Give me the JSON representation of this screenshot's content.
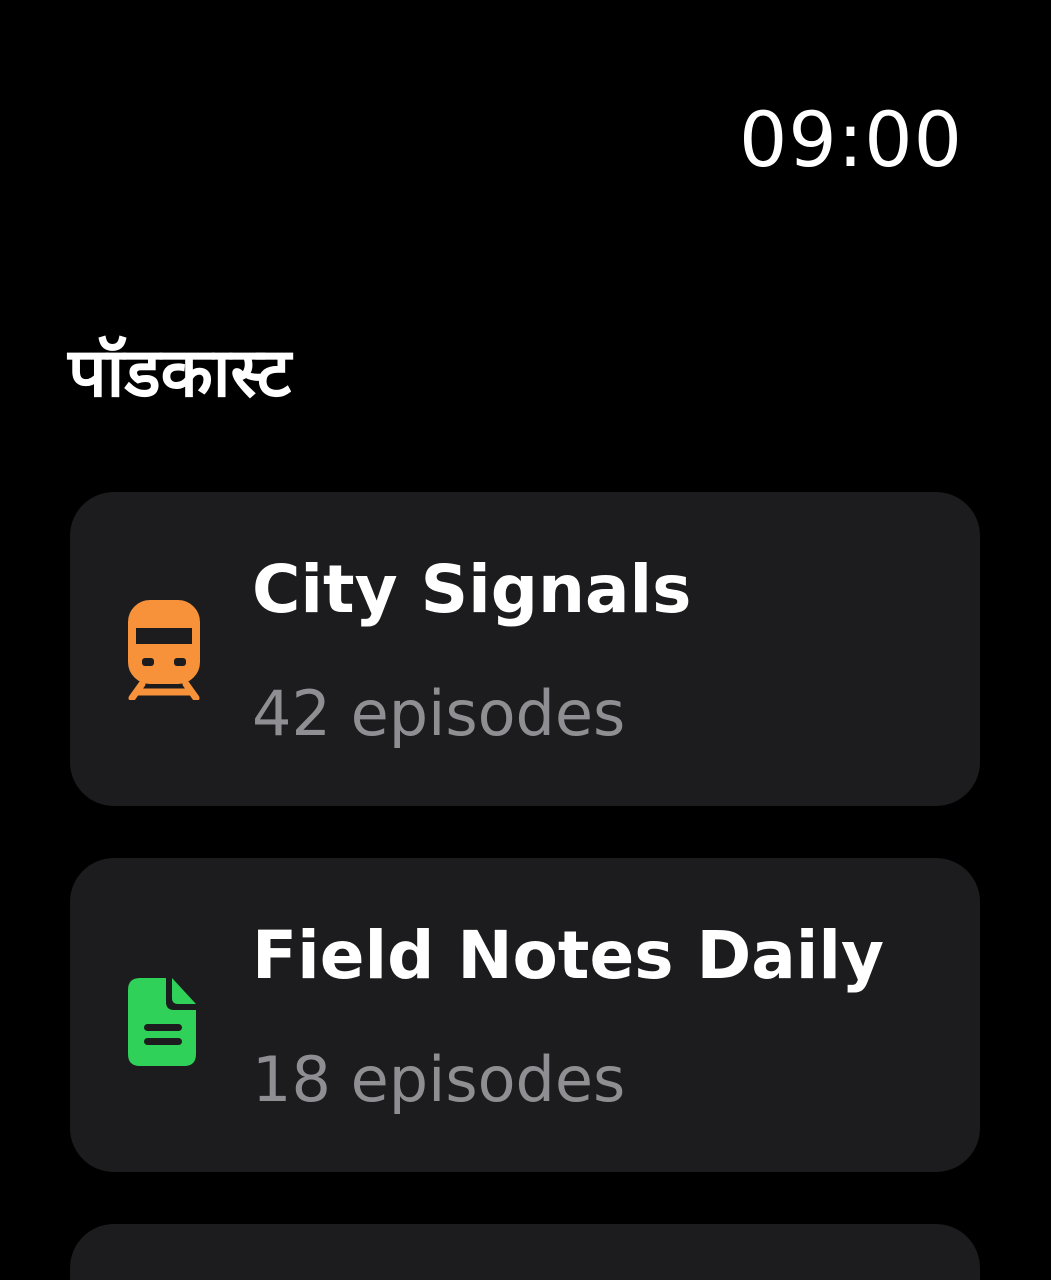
{
  "status": {
    "time": "09:00"
  },
  "header": {
    "title": "पॉडकास्ट"
  },
  "podcasts": [
    {
      "title": "City Signals",
      "subtitle": "42 episodes",
      "icon": "train-icon",
      "icon_color": "#f7913a"
    },
    {
      "title": "Field Notes Daily",
      "subtitle": "18 episodes",
      "icon": "document-icon",
      "icon_color": "#30d158"
    }
  ],
  "colors": {
    "background": "#000000",
    "card": "#1c1c1e",
    "secondary_text": "#8e8e93"
  }
}
